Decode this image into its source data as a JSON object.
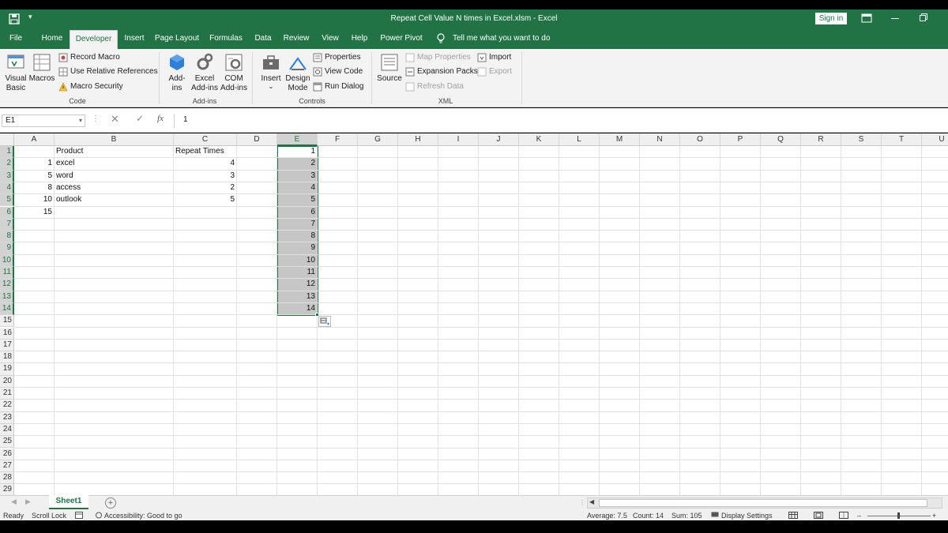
{
  "window": {
    "title": "Repeat Cell Value N times in Excel.xlsm  -  Excel",
    "signin": "Sign in"
  },
  "tabs": [
    "File",
    "Home",
    "Developer",
    "Insert",
    "Page Layout",
    "Formulas",
    "Data",
    "Review",
    "View",
    "Help",
    "Power Pivot"
  ],
  "active_tab": "Developer",
  "tell_me": "Tell me what you want to do",
  "ribbon": {
    "code": {
      "visual_basic_1": "Visual",
      "visual_basic_2": "Basic",
      "macros": "Macros",
      "record_macro": "Record Macro",
      "relative_refs": "Use Relative References",
      "macro_security": "Macro Security",
      "label": "Code"
    },
    "addins": {
      "addins_1": "Add-",
      "addins_2": "ins",
      "excel_addins_1": "Excel",
      "excel_addins_2": "Add-ins",
      "com_addins_1": "COM",
      "com_addins_2": "Add-ins",
      "label": "Add-ins"
    },
    "controls": {
      "insert": "Insert",
      "insert_arrow": "⌄",
      "design_1": "Design",
      "design_2": "Mode",
      "properties": "Properties",
      "view_code": "View Code",
      "run_dialog": "Run Dialog",
      "label": "Controls"
    },
    "xml": {
      "source": "Source",
      "map_properties": "Map Properties",
      "expansion_packs": "Expansion Packs",
      "refresh_data": "Refresh Data",
      "import": "Import",
      "export": "Export",
      "label": "XML"
    }
  },
  "formula_bar": {
    "name_box": "E1",
    "dropdown": "▾",
    "dots": "⋮",
    "cancel": "✕",
    "enter": "✓",
    "fx": "fx",
    "formula": "1"
  },
  "columns": [
    "A",
    "B",
    "C",
    "D",
    "E",
    "F",
    "G",
    "H",
    "I",
    "J",
    "K",
    "L",
    "M",
    "N",
    "O",
    "P",
    "Q",
    "R",
    "S",
    "T",
    "U"
  ],
  "rows": [
    "1",
    "2",
    "3",
    "4",
    "5",
    "6",
    "7",
    "8",
    "9",
    "10",
    "11",
    "12",
    "13",
    "14",
    "15",
    "16",
    "17",
    "18",
    "19",
    "20",
    "21",
    "22",
    "23",
    "24",
    "25",
    "26",
    "27",
    "28",
    "29"
  ],
  "cells": {
    "B1": "Product",
    "C1": "Repeat Times",
    "A2": "1",
    "B2": "excel",
    "C2": "4",
    "A3": "5",
    "B3": "word",
    "C3": "3",
    "A4": "8",
    "B4": "access",
    "C4": "2",
    "A5": "10",
    "B5": "outlook",
    "C5": "5",
    "A6": "15",
    "E1": "1",
    "E2": "2",
    "E3": "3",
    "E4": "4",
    "E5": "5",
    "E6": "6",
    "E7": "7",
    "E8": "8",
    "E9": "9",
    "E10": "10",
    "E11": "11",
    "E12": "12",
    "E13": "13",
    "E14": "14"
  },
  "selection": "E1:E14",
  "sheet": {
    "name": "Sheet1",
    "add": "+",
    "nav_prev": "◀",
    "nav_next": "▶",
    "split": "⋮",
    "scroll_left": "◀"
  },
  "status": {
    "ready": "Ready",
    "scroll_lock": "Scroll Lock",
    "accessibility": "Accessibility: Good to go",
    "average": "Average: 7.5",
    "count": "Count: 14",
    "sum": "Sum: 105",
    "display_settings": "Display Settings",
    "zoom_minus": "–",
    "zoom_plus": "+"
  },
  "colors": {
    "accent": "#217346",
    "selection": "#c6c6c6"
  }
}
